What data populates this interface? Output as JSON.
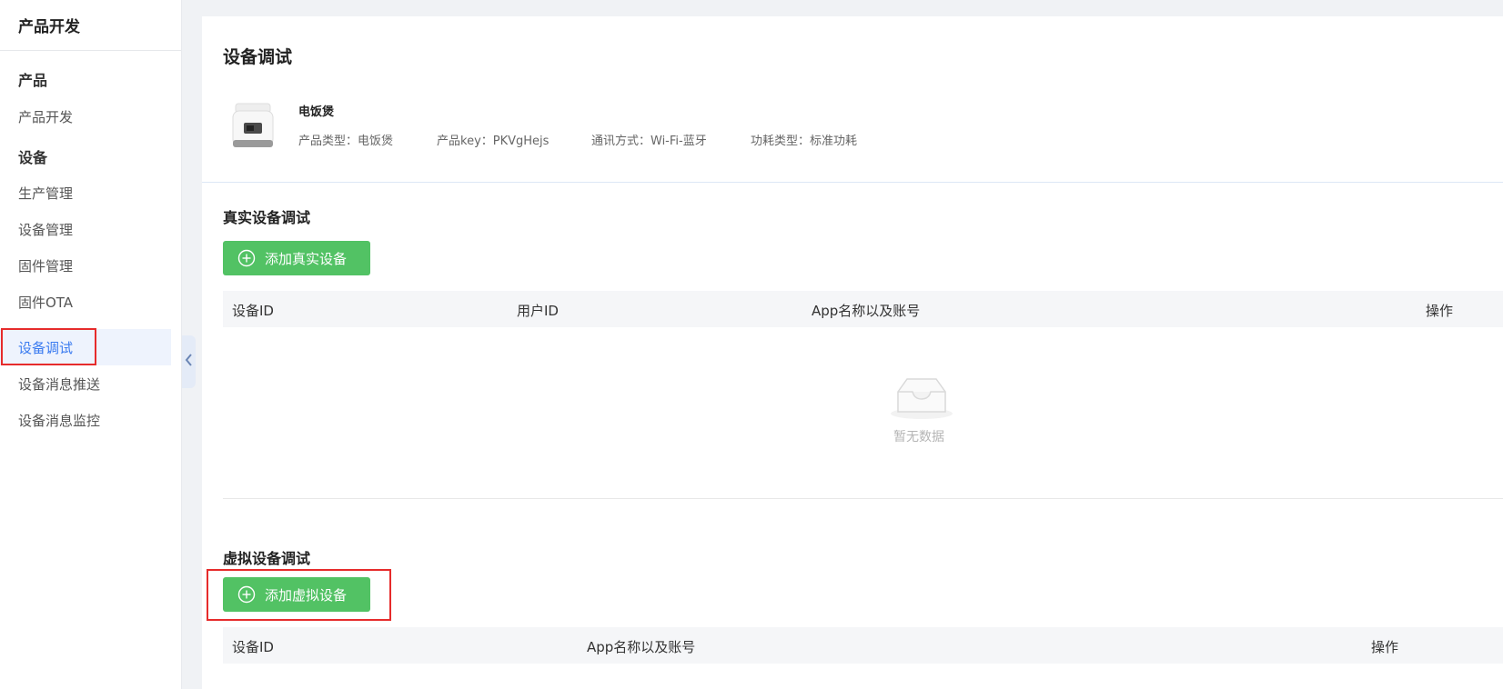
{
  "sidebar": {
    "title": "产品开发",
    "groups": {
      "product": "产品",
      "device": "设备"
    },
    "items": {
      "product_dev": "产品开发",
      "production": "生产管理",
      "device_mgmt": "设备管理",
      "firmware_mgmt": "固件管理",
      "firmware_ota": "固件OTA",
      "device_debug": "设备调试",
      "message_push": "设备消息推送",
      "message_monitor": "设备消息监控"
    },
    "active_item": "设备调试"
  },
  "page": {
    "title": "设备调试"
  },
  "product": {
    "name": "电饭煲",
    "type": "产品类型：电饭煲",
    "key": "产品key：PKVgHejs",
    "comm": "通讯方式：Wi-Fi-蓝牙",
    "power": "功耗类型：标准功耗"
  },
  "real_section": {
    "title": "真实设备调试",
    "add_button": "添加真实设备",
    "columns": [
      "设备ID",
      "用户ID",
      "App名称以及账号",
      "操作"
    ],
    "empty_text": "暂无数据"
  },
  "virtual_section": {
    "title": "虚拟设备调试",
    "add_button": "添加虚拟设备",
    "columns": [
      "设备ID",
      "App名称以及账号",
      "操作"
    ]
  },
  "colors": {
    "accent_blue": "#3a7bf0",
    "button_green": "#52c264",
    "highlight_red": "#e62b2b"
  }
}
